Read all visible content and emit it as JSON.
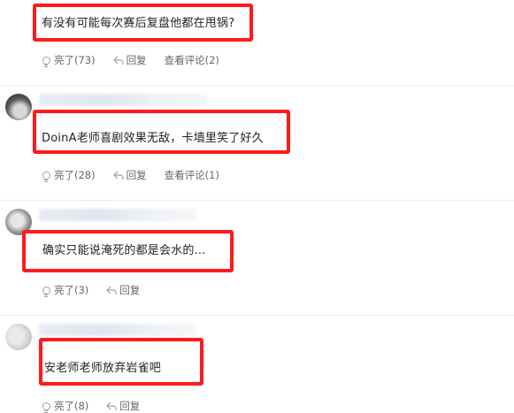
{
  "comments": [
    {
      "text": "有没有可能每次赛后复盘他都在甩锅?",
      "like_label": "亮了(73)",
      "reply_label": "回复",
      "view_replies_label": "查看评论(2)"
    },
    {
      "text": "DoinA老师喜剧效果无敌，卡墙里笑了好久",
      "like_label": "亮了(28)",
      "reply_label": "回复",
      "view_replies_label": "查看评论(1)"
    },
    {
      "text": "确实只能说淹死的都是会水的...",
      "like_label": "亮了(3)",
      "reply_label": "回复"
    },
    {
      "text": "安老师老师放弃岩雀吧",
      "like_label": "亮了(8)",
      "reply_label": "回复"
    }
  ],
  "colors": {
    "highlight_border": "#ff1a1a",
    "divider": "#ececec",
    "action_text": "#666666"
  },
  "icons": {
    "like": "lightbulb-icon",
    "reply": "reply-arrow-icon"
  }
}
